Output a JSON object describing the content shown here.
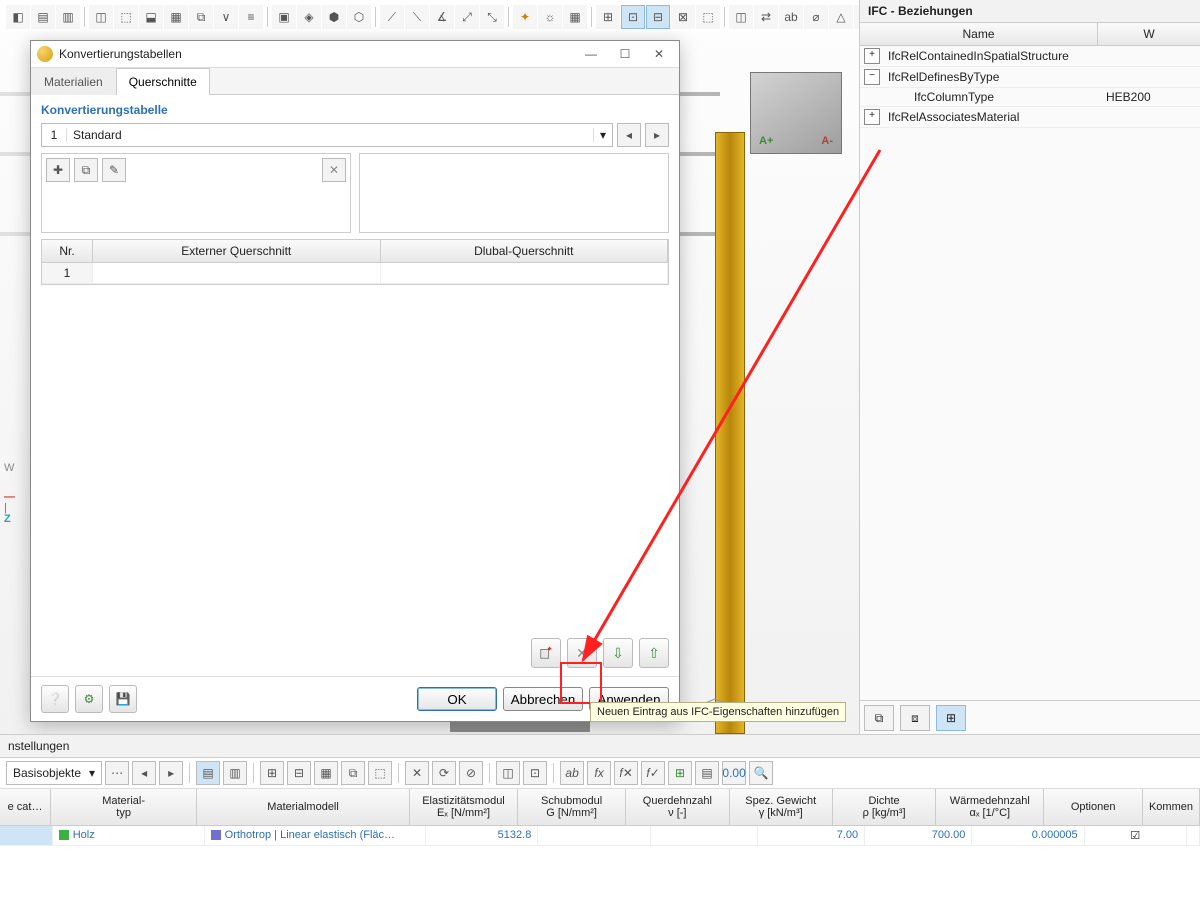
{
  "dialog": {
    "title": "Konvertierungstabellen",
    "tabs": {
      "materials": "Materialien",
      "sections": "Querschnitte"
    },
    "group_title": "Konvertierungstabelle",
    "combo": {
      "num": "1",
      "text": "Standard"
    },
    "table": {
      "headers": {
        "nr": "Nr.",
        "ext": "Externer Querschnitt",
        "dlubal": "Dlubal-Querschnitt"
      },
      "rows": [
        {
          "nr": "1",
          "ext": "",
          "dlubal": ""
        }
      ]
    },
    "tooltip": "Neuen Eintrag aus IFC-Eigenschaften hinzufügen",
    "buttons": {
      "ok": "OK",
      "cancel": "Abbrechen",
      "apply": "Anwenden"
    }
  },
  "right_panel": {
    "title": "IFC - Beziehungen",
    "headers": {
      "name": "Name",
      "value": "W"
    },
    "rows": [
      {
        "expand": "+",
        "label": "IfcRelContainedInSpatialStructure",
        "value": ""
      },
      {
        "expand": "−",
        "label": "IfcRelDefinesByType",
        "value": ""
      },
      {
        "indent": true,
        "label": "IfcColumnType",
        "value": "HEB200"
      },
      {
        "expand": "+",
        "label": "IfcRelAssociatesMaterial",
        "value": ""
      }
    ]
  },
  "bottom_panel": {
    "title": "nstellungen",
    "combo": "Basisobjekte",
    "headers": {
      "cat": "e cat…",
      "type": "Material-\ntyp",
      "model": "Materialmodell",
      "emod": "Elastizitätsmodul\nEₓ [N/mm²]",
      "gmod": "Schubmodul\nG [N/mm²]",
      "nu": "Querdehnzahl\nν [-]",
      "gamma": "Spez. Gewicht\nγ [kN/m³]",
      "rho": "Dichte\nρ [kg/m³]",
      "alpha": "Wärmedehnzahl\nαₓ [1/°C]",
      "opt": "Optionen",
      "comment": "Kommen"
    },
    "row": {
      "cat": "",
      "type": "Holz",
      "model": "Orthotrop | Linear elastisch (Fläc…",
      "emod": "5132.8",
      "gmod": "",
      "nu": "",
      "gamma": "7.00",
      "rho": "700.00",
      "alpha": "0.000005",
      "opt": "☑",
      "swatch_type": "#3bb143",
      "swatch_model": "#7070d0"
    }
  },
  "axis": {
    "w": "W",
    "z": "Z"
  },
  "cube": {
    "a1": "A+",
    "a2": "A-"
  },
  "colors": {
    "accent": "#2d6fb8",
    "highlight": "#ff2020"
  }
}
